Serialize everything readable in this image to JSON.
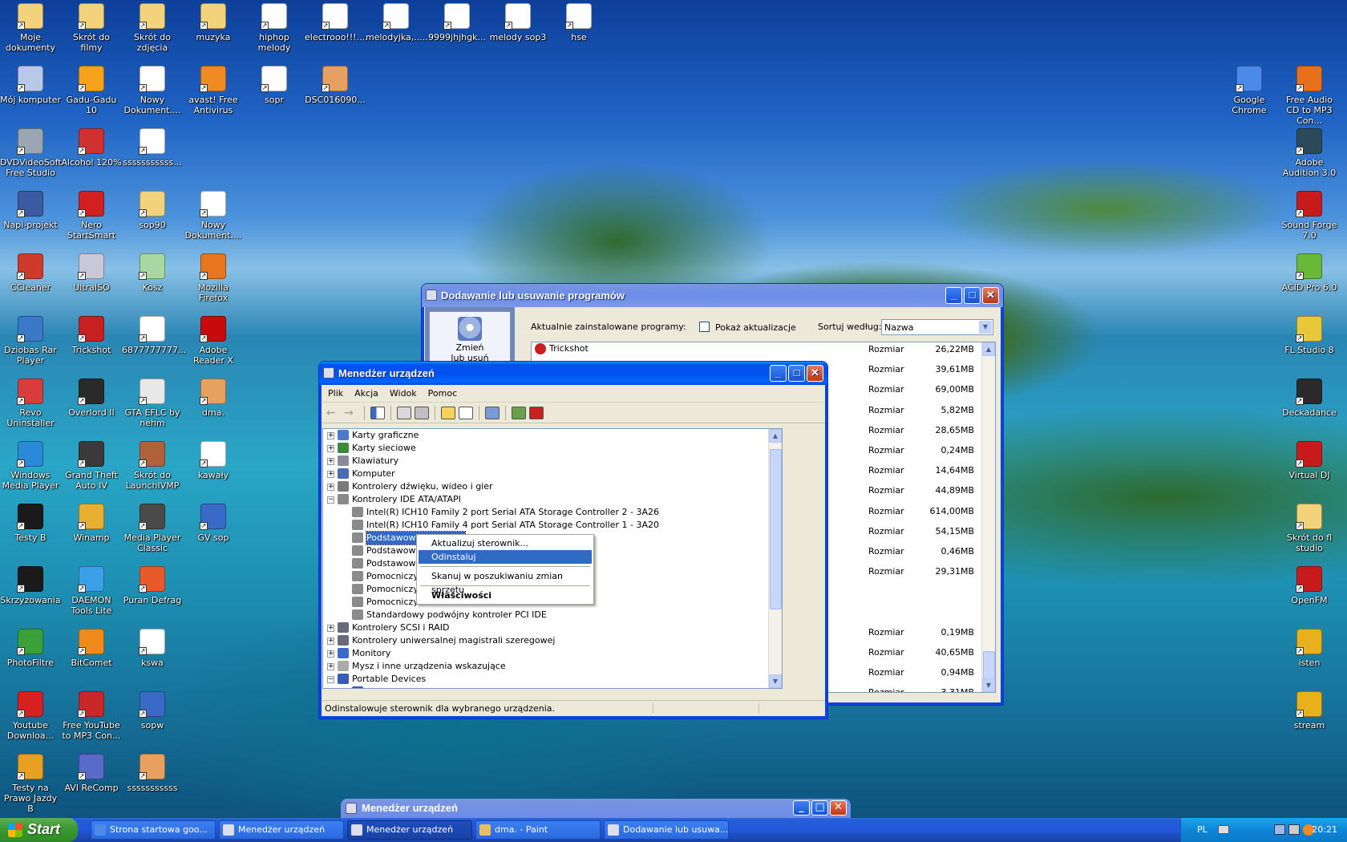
{
  "desktop": {
    "icons": [
      {
        "label": "Moje dokumenty",
        "color": "#f2d27a"
      },
      {
        "label": "Skrót do filmy",
        "color": "#f2d27a"
      },
      {
        "label": "Skrót do zdjęcia",
        "color": "#f2d27a"
      },
      {
        "label": "muzyka",
        "color": "#f2d27a"
      },
      {
        "label": "hiphop melody",
        "color": "#ffffff"
      },
      {
        "label": "electrooo!!!....",
        "color": "#ffffff"
      },
      {
        "label": "melodyjka,.....",
        "color": "#ffffff"
      },
      {
        "label": "9999jhjhgk...",
        "color": "#ffffff"
      },
      {
        "label": "melody sop3",
        "color": "#ffffff"
      },
      {
        "label": "hse",
        "color": "#ffffff"
      },
      {
        "label": "Mój komputer",
        "color": "#b8c8e8"
      },
      {
        "label": "Gadu-Gadu 10",
        "color": "#f6a21a"
      },
      {
        "label": "Nowy Dokument....",
        "color": "#ffffff"
      },
      {
        "label": "avast! Free Antivirus",
        "color": "#f08a24"
      },
      {
        "label": "sopr",
        "color": "#ffffff"
      },
      {
        "label": "DSC016090...",
        "color": "#e8a060"
      },
      {
        "label": "DVDVideoSoft Free Studio",
        "color": "#9aa6b2"
      },
      {
        "label": "Alcohol 120%",
        "color": "#d03030"
      },
      {
        "label": "sssssssssss...",
        "color": "#ffffff"
      },
      {
        "label": "Napi-projekt",
        "color": "#3c5aa0"
      },
      {
        "label": "Nero StartSmart",
        "color": "#d02020"
      },
      {
        "label": "sop90",
        "color": "#f2d27a"
      },
      {
        "label": "Nowy Dokument....",
        "color": "#ffffff"
      },
      {
        "label": "CCleaner",
        "color": "#d03a2a"
      },
      {
        "label": "UltraISO",
        "color": "#c8c8d8"
      },
      {
        "label": "Kosz",
        "color": "#a8d8a0"
      },
      {
        "label": "Mozilla Firefox",
        "color": "#e8761c"
      },
      {
        "label": "Dziobas Rar Player",
        "color": "#3a78c8"
      },
      {
        "label": "Trickshot",
        "color": "#c82020"
      },
      {
        "label": "6877777777...",
        "color": "#ffffff"
      },
      {
        "label": "Adobe Reader X",
        "color": "#c80a0a"
      },
      {
        "label": "Revo Uninstaller",
        "color": "#d83c3c"
      },
      {
        "label": "Overlord II",
        "color": "#2a2a2a"
      },
      {
        "label": "GTA EFLC by nehm",
        "color": "#e8e8e8"
      },
      {
        "label": "dma.",
        "color": "#e8a060"
      },
      {
        "label": "Windows Media Player",
        "color": "#2a8ad8"
      },
      {
        "label": "Grand Theft Auto IV",
        "color": "#3a3a3a"
      },
      {
        "label": "Skrót do LaunchIVMP",
        "color": "#b0603a"
      },
      {
        "label": "kawały",
        "color": "#ffffff"
      },
      {
        "label": "Testy B",
        "color": "#1a1a1a"
      },
      {
        "label": "Winamp",
        "color": "#e8b030"
      },
      {
        "label": "Media Player Classic",
        "color": "#4a4a4a"
      },
      {
        "label": "GV sop",
        "color": "#3a6ac8"
      },
      {
        "label": "Skrzyżowania",
        "color": "#1a1a1a"
      },
      {
        "label": "DAEMON Tools Lite",
        "color": "#3aa0e8"
      },
      {
        "label": "Puran Defrag",
        "color": "#e85a2a"
      },
      {
        "label": "PhotoFiltre",
        "color": "#3aa03a"
      },
      {
        "label": "BitComet",
        "color": "#f08a1a"
      },
      {
        "label": "kswa",
        "color": "#ffffff"
      },
      {
        "label": "Youtube Downloa...",
        "color": "#d82020"
      },
      {
        "label": "Free YouTube to MP3 Con...",
        "color": "#c82828"
      },
      {
        "label": "sopw",
        "color": "#3a6ac8"
      },
      {
        "label": "Testy na Prawo Jazdy B",
        "color": "#e8a020"
      },
      {
        "label": "AVI ReComp",
        "color": "#5a6ac8"
      },
      {
        "label": "sssssssssss",
        "color": "#e8a060"
      },
      {
        "label": "Google Chrome",
        "color": "#4a8ae8"
      },
      {
        "label": "Free Audio CD to MP3 Con...",
        "color": "#e8701a"
      },
      {
        "label": "Adobe Audition 3.0",
        "color": "#2a4a5a"
      },
      {
        "label": "Sound Forge 7.0",
        "color": "#c81a1a"
      },
      {
        "label": "ACID Pro 6.0",
        "color": "#6ab83a"
      },
      {
        "label": "FL Studio 8",
        "color": "#e8c83a"
      },
      {
        "label": "Deckadance",
        "color": "#2a2a2a"
      },
      {
        "label": "Virtual DJ",
        "color": "#c81a1a"
      },
      {
        "label": "Skrót do fl studio",
        "color": "#f2d27a"
      },
      {
        "label": "OpenFM",
        "color": "#c81a1a"
      },
      {
        "label": "isten",
        "color": "#e8b01a"
      },
      {
        "label": "stream",
        "color": "#e8b01a"
      }
    ]
  },
  "addremove": {
    "title": "Dodawanie lub usuwanie programów",
    "sidebar_button": "Zmień lub usuń",
    "installed_label": "Aktualnie zainstalowane programy:",
    "show_updates_label": "Pokaż aktualizacje",
    "sort_label": "Sortuj według:",
    "sort_value": "Nazwa",
    "first_program": "Trickshot",
    "size_label": "Rozmiar",
    "sizes": [
      "26,22MB",
      "39,61MB",
      "69,00MB",
      "5,82MB",
      "28,65MB",
      "0,24MB",
      "14,64MB",
      "44,89MB",
      "614,00MB",
      "54,15MB",
      "0,46MB",
      "29,31MB",
      "0,19MB",
      "40,65MB",
      "0,94MB",
      "3,31MB"
    ]
  },
  "devmgr": {
    "title": "Menedżer urządzeń",
    "menu": [
      "Plik",
      "Akcja",
      "Widok",
      "Pomoc"
    ],
    "tree": [
      {
        "label": "Karty graficzne",
        "level": 0,
        "expander": "+",
        "color": "#4a7ac8"
      },
      {
        "label": "Karty sieciowe",
        "level": 0,
        "expander": "+",
        "color": "#3a8a3a"
      },
      {
        "label": "Klawiatury",
        "level": 0,
        "expander": "+",
        "color": "#8a8a9a"
      },
      {
        "label": "Komputer",
        "level": 0,
        "expander": "+",
        "color": "#4a6ab8"
      },
      {
        "label": "Kontrolery dźwięku, wideo i gier",
        "level": 0,
        "expander": "+",
        "color": "#7a7a7a"
      },
      {
        "label": "Kontrolery IDE ATA/ATAPI",
        "level": 0,
        "expander": "-",
        "color": "#8a8a8a"
      },
      {
        "label": "Intel(R) ICH10 Family 2 port Serial ATA Storage Controller 2 - 3A26",
        "level": 1,
        "expander": "",
        "color": "#8a8a8a"
      },
      {
        "label": "Intel(R) ICH10 Family 4 port Serial ATA Storage Controller 1 - 3A20",
        "level": 1,
        "expander": "",
        "color": "#8a8a8a"
      },
      {
        "label": "Podstawowy kanał IDE",
        "level": 1,
        "expander": "",
        "color": "#8a8a8a",
        "selected": true
      },
      {
        "label": "Podstawowy kanał IDE",
        "level": 1,
        "expander": "",
        "color": "#8a8a8a"
      },
      {
        "label": "Podstawowy kanał IDE",
        "level": 1,
        "expander": "",
        "color": "#8a8a8a"
      },
      {
        "label": "Pomocniczy kanał IDE",
        "level": 1,
        "expander": "",
        "color": "#8a8a8a"
      },
      {
        "label": "Pomocniczy kanał IDE",
        "level": 1,
        "expander": "",
        "color": "#8a8a8a"
      },
      {
        "label": "Pomocniczy kanał IDE",
        "level": 1,
        "expander": "",
        "color": "#8a8a8a"
      },
      {
        "label": "Standardowy podwójny kontroler PCI IDE",
        "level": 1,
        "expander": "",
        "color": "#8a8a8a"
      },
      {
        "label": "Kontrolery SCSI i RAID",
        "level": 0,
        "expander": "+",
        "color": "#6a6a7a"
      },
      {
        "label": "Kontrolery uniwersalnej magistrali szeregowej",
        "level": 0,
        "expander": "+",
        "color": "#6a6a7a"
      },
      {
        "label": "Monitory",
        "level": 0,
        "expander": "+",
        "color": "#3a6ac8"
      },
      {
        "label": "Mysz i inne urządzenia wskazujące",
        "level": 0,
        "expander": "+",
        "color": "#aaaaaa"
      },
      {
        "label": "Portable Devices",
        "level": 0,
        "expander": "-",
        "color": "#3a5ab8"
      },
      {
        "label": "MTP Device",
        "level": 1,
        "expander": "",
        "color": "#3a5ab8"
      }
    ],
    "status": "Odinstalowuje sterownik dla wybranego urządzenia."
  },
  "context_menu": {
    "items": [
      "Aktualizuj sterownik...",
      "Odinstaluj",
      "Skanuj w poszukiwaniu zmian sprzętu",
      "Właściwości"
    ],
    "selected_index": 1
  },
  "devmgr2": {
    "title": "Menedżer urządzeń"
  },
  "taskbar": {
    "start": "Start",
    "items": [
      {
        "label": "Strona startowa goo...",
        "color": "#4a8ae8"
      },
      {
        "label": "Menedżer urządzeń",
        "color": "#dde"
      },
      {
        "label": "Menedżer urządzeń",
        "color": "#dde",
        "active": true
      },
      {
        "label": "dma. - Paint",
        "color": "#e8c060"
      },
      {
        "label": "Dodawanie lub usuwa...",
        "color": "#dde"
      }
    ],
    "lang": "PL",
    "clock": "20:21"
  }
}
